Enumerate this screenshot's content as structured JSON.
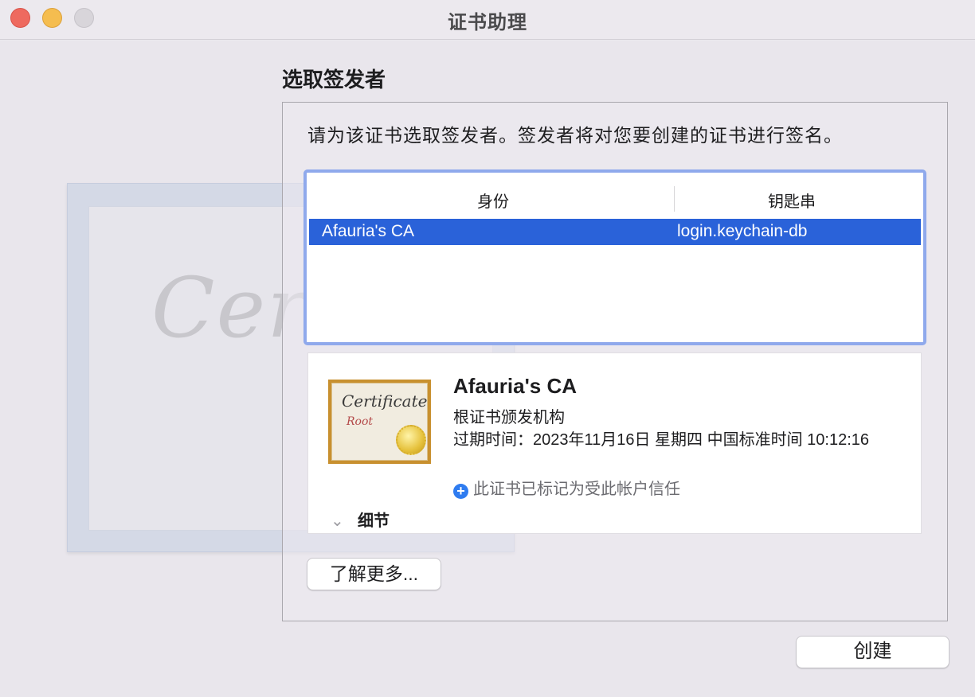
{
  "window": {
    "title": "证书助理"
  },
  "background_art": {
    "script_text": "Certi"
  },
  "section": {
    "title": "选取签发者",
    "instruction": "请为该证书选取签发者。签发者将对您要创建的证书进行签名。"
  },
  "issuer_table": {
    "columns": [
      "身份",
      "钥匙串"
    ],
    "rows": [
      {
        "identity": "Afauria's CA",
        "keychain": "login.keychain-db",
        "selected": true
      }
    ]
  },
  "certificate_detail": {
    "icon_title": "Certificate",
    "icon_subtitle": "Root",
    "name": "Afauria's CA",
    "kind": "根证书颁发机构",
    "expiry": "过期时间：2023年11月16日 星期四 中国标准时间 10:12:16",
    "trust_icon": "plus-circle-icon",
    "trust_text": "此证书已标记为受此帐户信任",
    "details_label": "细节"
  },
  "buttons": {
    "learn_more": "了解更多...",
    "create": "创建"
  },
  "colors": {
    "selection": "#2a62d9",
    "focus_ring": "#8fa9ec",
    "close": "#ee6a5f",
    "minimize": "#f5bd4f"
  }
}
